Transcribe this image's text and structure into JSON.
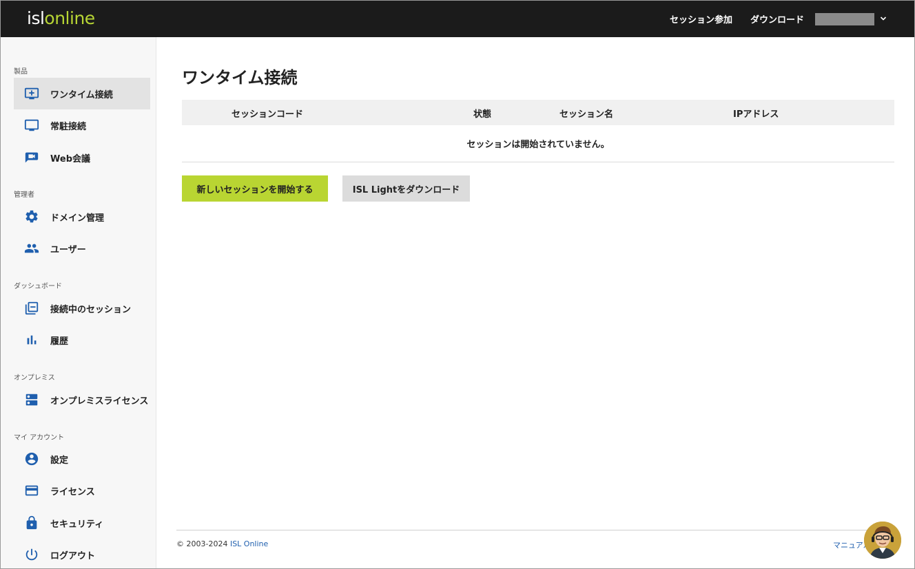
{
  "header": {
    "logo_isl": "isl",
    "logo_online": "online",
    "join_session": "セッション参加",
    "download": "ダウンロード",
    "user_menu_icon": "chevron-down-icon"
  },
  "sidebar": {
    "sections": [
      {
        "label": "製品",
        "items": [
          {
            "label": "ワンタイム接続",
            "icon": "monitor-plus-icon",
            "active": true
          },
          {
            "label": "常駐接続",
            "icon": "monitor-icon"
          },
          {
            "label": "Web会議",
            "icon": "video-call-icon"
          }
        ]
      },
      {
        "label": "管理者",
        "items": [
          {
            "label": "ドメイン管理",
            "icon": "gear-icon"
          },
          {
            "label": "ユーザー",
            "icon": "users-icon"
          }
        ]
      },
      {
        "label": "ダッシュボード",
        "items": [
          {
            "label": "接続中のセッション",
            "icon": "sessions-icon"
          },
          {
            "label": "履歴",
            "icon": "bar-chart-icon"
          }
        ]
      },
      {
        "label": "オンプレミス",
        "items": [
          {
            "label": "オンプレミスライセンス",
            "icon": "server-icon"
          }
        ]
      },
      {
        "label": "マイ アカウント",
        "items": [
          {
            "label": "設定",
            "icon": "account-icon"
          },
          {
            "label": "ライセンス",
            "icon": "credit-card-icon"
          },
          {
            "label": "セキュリティ",
            "icon": "lock-icon"
          },
          {
            "label": "ログアウト",
            "icon": "power-icon"
          }
        ]
      }
    ]
  },
  "main": {
    "title": "ワンタイム接続",
    "table": {
      "columns": [
        "セッションコード",
        "状態",
        "セッション名",
        "IPアドレス"
      ],
      "empty_message": "セッションは開始されていません。"
    },
    "buttons": {
      "new_session": "新しいセッションを開始する",
      "download_light": "ISL Lightをダウンロード"
    }
  },
  "footer": {
    "copyright": "© 2003-2024 ",
    "company": "ISL Online",
    "manual": "マニュアル"
  },
  "colors": {
    "accent": "#b9d532",
    "link": "#1f5fae",
    "header_bg": "#1b1b1b"
  }
}
